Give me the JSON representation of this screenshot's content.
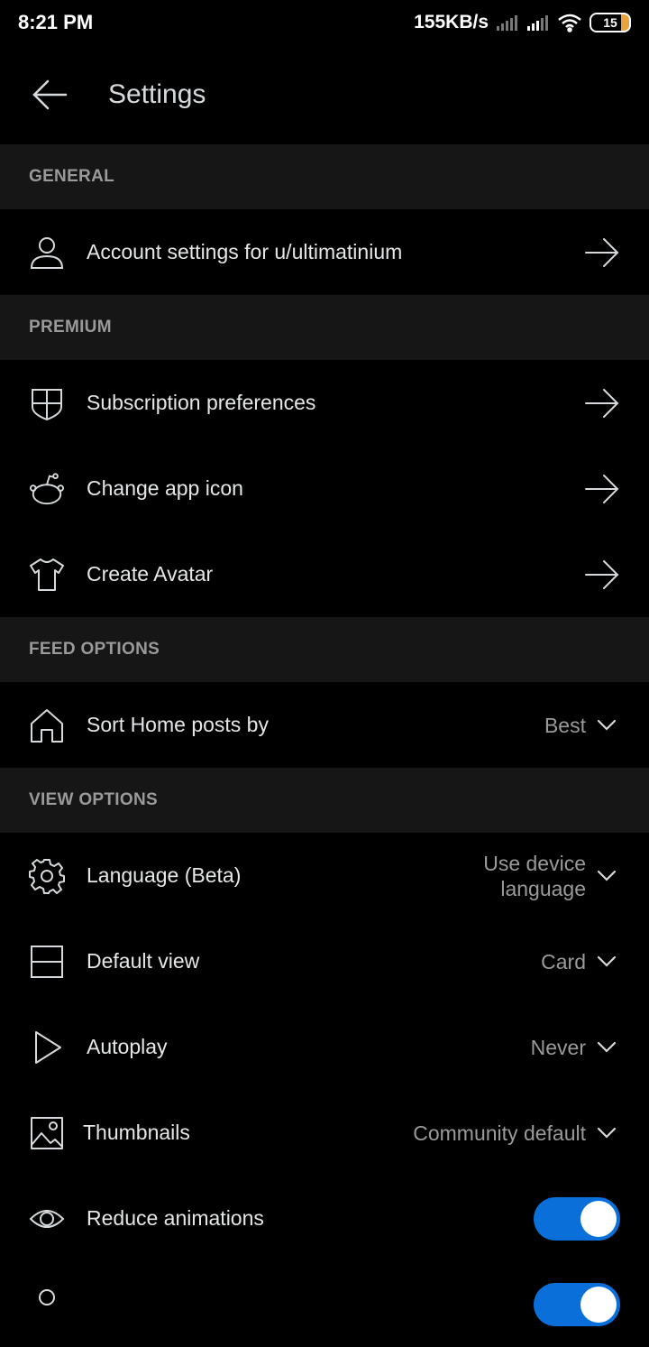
{
  "status": {
    "time": "8:21 PM",
    "network_speed": "155KB/s",
    "battery": "15"
  },
  "header": {
    "title": "Settings"
  },
  "sections": {
    "general": "GENERAL",
    "premium": "PREMIUM",
    "feed": "FEED OPTIONS",
    "view": "VIEW OPTIONS"
  },
  "rows": {
    "account": "Account settings for u/ultimatinium",
    "subscription": "Subscription preferences",
    "app_icon": "Change app icon",
    "avatar": "Create Avatar",
    "sort_home": "Sort Home posts by",
    "sort_home_value": "Best",
    "language": "Language (Beta)",
    "language_value": "Use device language",
    "default_view": "Default view",
    "default_view_value": "Card",
    "autoplay": "Autoplay",
    "autoplay_value": "Never",
    "thumbnails": "Thumbnails",
    "thumbnails_value": "Community default",
    "reduce_animations": "Reduce animations"
  },
  "toggles": {
    "reduce_animations": true
  },
  "colors": {
    "background": "#000000",
    "section_header": "#161616",
    "toggle_on": "#0a6fd8"
  }
}
